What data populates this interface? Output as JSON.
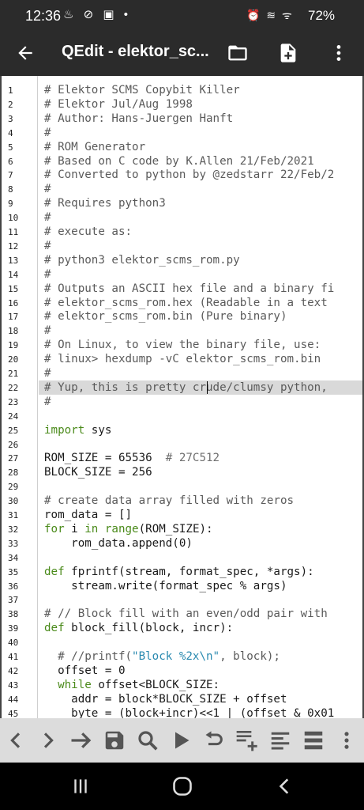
{
  "status_bar": {
    "time": "12:36",
    "left_icons": "♨ ⊘ ▣ •",
    "right_icons": "⏰ ≋ ᯤ",
    "battery": "72%"
  },
  "app_bar": {
    "title": "QEdit - elektor_sc...",
    "back_icon": "arrow-left-icon",
    "folder_icon": "folder-icon",
    "new_file_icon": "file-plus-icon",
    "menu_icon": "more-vert-icon"
  },
  "editor": {
    "line_numbers": [
      "1",
      "2",
      "3",
      "4",
      "5",
      "6",
      "7",
      "8",
      "9",
      "10",
      "11",
      "12",
      "13",
      "14",
      "15",
      "16",
      "17",
      "18",
      "19",
      "20",
      "21",
      "22",
      "23",
      "24",
      "25",
      "26",
      "27",
      "28",
      "29",
      "30",
      "31",
      "32",
      "33",
      "34",
      "35",
      "36",
      "37",
      "38",
      "39",
      "40",
      "41",
      "42",
      "43",
      "44",
      "45"
    ],
    "highlighted_line": 22,
    "lines": [
      [
        {
          "t": "# Elektor SCMS Copybit Killer",
          "c": "comment"
        }
      ],
      [
        {
          "t": "# Elektor Jul/Aug 1998",
          "c": "comment"
        }
      ],
      [
        {
          "t": "# Author: Hans-Juergen Hanft",
          "c": "comment"
        }
      ],
      [
        {
          "t": "#",
          "c": "comment"
        }
      ],
      [
        {
          "t": "# ROM Generator",
          "c": "comment"
        }
      ],
      [
        {
          "t": "# Based on C code by K.Allen 21/Feb/2021",
          "c": "comment"
        }
      ],
      [
        {
          "t": "# Converted to python by @zedstarr 22/Feb/2",
          "c": "comment"
        }
      ],
      [
        {
          "t": "#",
          "c": "comment"
        }
      ],
      [
        {
          "t": "# Requires python3",
          "c": "comment"
        }
      ],
      [
        {
          "t": "#",
          "c": "comment"
        }
      ],
      [
        {
          "t": "# execute as:",
          "c": "comment"
        }
      ],
      [
        {
          "t": "#",
          "c": "comment"
        }
      ],
      [
        {
          "t": "# python3 elektor_scms_rom.py",
          "c": "comment"
        }
      ],
      [
        {
          "t": "#",
          "c": "comment"
        }
      ],
      [
        {
          "t": "# Outputs an ASCII hex file and a binary fi",
          "c": "comment"
        }
      ],
      [
        {
          "t": "# elektor_scms_rom.hex (Readable in a text",
          "c": "comment"
        }
      ],
      [
        {
          "t": "# elektor_scms_rom.bin (Pure binary)",
          "c": "comment"
        }
      ],
      [
        {
          "t": "#",
          "c": "comment"
        }
      ],
      [
        {
          "t": "# On Linux, to view the binary file, use:",
          "c": "comment"
        }
      ],
      [
        {
          "t": "# linux> hexdump -vC elektor_scms_rom.bin",
          "c": "comment"
        }
      ],
      [
        {
          "t": "#",
          "c": "comment"
        }
      ],
      [
        {
          "t": "# Yup, this is pretty crude/clumsy python,",
          "c": "comment"
        }
      ],
      [
        {
          "t": "#",
          "c": "comment"
        }
      ],
      [
        {
          "t": "",
          "c": "plain"
        }
      ],
      [
        {
          "t": "import",
          "c": "kw"
        },
        {
          "t": " sys",
          "c": "plain"
        }
      ],
      [
        {
          "t": "",
          "c": "plain"
        }
      ],
      [
        {
          "t": "ROM_SIZE = 65536  ",
          "c": "plain"
        },
        {
          "t": "# 27C512",
          "c": "cm2"
        }
      ],
      [
        {
          "t": "BLOCK_SIZE = 256",
          "c": "plain"
        }
      ],
      [
        {
          "t": "",
          "c": "plain"
        }
      ],
      [
        {
          "t": "# create data array filled with zeros",
          "c": "comment"
        }
      ],
      [
        {
          "t": "rom_data = []",
          "c": "plain"
        }
      ],
      [
        {
          "t": "for",
          "c": "kw"
        },
        {
          "t": " i ",
          "c": "plain"
        },
        {
          "t": "in",
          "c": "kw"
        },
        {
          "t": " ",
          "c": "plain"
        },
        {
          "t": "range",
          "c": "kw"
        },
        {
          "t": "(ROM_SIZE):",
          "c": "plain"
        }
      ],
      [
        {
          "t": "    rom_data.append(0)",
          "c": "plain"
        }
      ],
      [
        {
          "t": "",
          "c": "plain"
        }
      ],
      [
        {
          "t": "def",
          "c": "kw"
        },
        {
          "t": " fprintf(stream, format_spec, *args):",
          "c": "plain"
        }
      ],
      [
        {
          "t": "    stream.write(format_spec % args)",
          "c": "plain"
        }
      ],
      [
        {
          "t": "",
          "c": "plain"
        }
      ],
      [
        {
          "t": "# // Block fill with an even/odd pair with",
          "c": "comment"
        }
      ],
      [
        {
          "t": "def",
          "c": "kw"
        },
        {
          "t": " block_fill(block, incr):",
          "c": "plain"
        }
      ],
      [
        {
          "t": "",
          "c": "plain"
        }
      ],
      [
        {
          "t": "  # //printf(",
          "c": "comment"
        },
        {
          "t": "\"Block %2x\\n\"",
          "c": "str"
        },
        {
          "t": ", block);",
          "c": "comment"
        }
      ],
      [
        {
          "t": "  offset = 0",
          "c": "plain"
        }
      ],
      [
        {
          "t": "  ",
          "c": "plain"
        },
        {
          "t": "while",
          "c": "kw"
        },
        {
          "t": " offset<BLOCK_SIZE:",
          "c": "plain"
        }
      ],
      [
        {
          "t": "    addr = block*BLOCK_SIZE + offset",
          "c": "plain"
        }
      ],
      [
        {
          "t": "    byte = (block+incr)<<1 | (offset & 0x01",
          "c": "plain"
        }
      ]
    ]
  },
  "toolbar": {
    "icons": [
      "chevron-left-icon",
      "chevron-right-icon",
      "goto-arrow-icon",
      "save-icon",
      "search-icon",
      "run-icon",
      "undo-icon",
      "add-line-icon",
      "align-left-icon",
      "list-icon",
      "more-vert-icon"
    ]
  },
  "nav_bar": {
    "icons": [
      "recent-apps-icon",
      "home-icon",
      "back-icon"
    ]
  }
}
